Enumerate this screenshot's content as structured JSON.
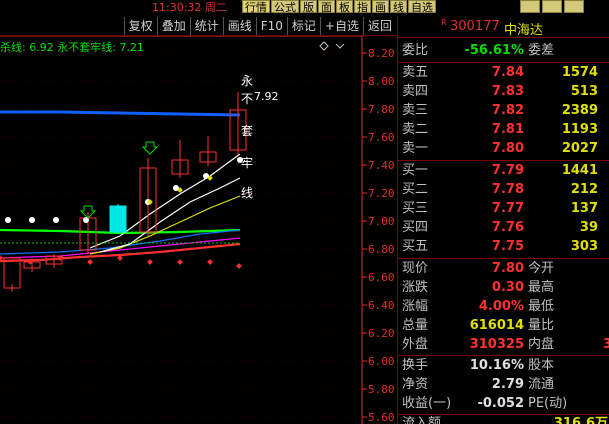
{
  "topbar": {
    "clock": "11:30:32 周二",
    "menu": [
      "行情",
      "公式",
      "版",
      "面",
      "板",
      "指",
      "画",
      "线",
      "自选"
    ],
    "menu_selected": 0
  },
  "toolbar": {
    "buttons": [
      "复权",
      "叠加",
      "统计",
      "画线",
      "F10",
      "标记",
      "+自选",
      "返回"
    ]
  },
  "chart": {
    "indicator_prefix": "杀线:",
    "indicator_value1": "6.92",
    "indicator_label2": "永不套牢线:",
    "indicator_value2": "7.21",
    "y_labels": [
      "8.20",
      "8.00",
      "7.80",
      "7.60",
      "7.40",
      "7.20",
      "7.00",
      "6.80",
      "6.60",
      "6.40",
      "6.20",
      "6.00",
      "5.80",
      "5.60"
    ],
    "annotation_chars": [
      "永",
      "不",
      "套",
      "牢",
      "线"
    ],
    "annotation_price": "7.92",
    "colors": {
      "up": "#ff3030",
      "down": "#00e8e8",
      "axis": "#e03030",
      "blue_line": "#1060ff"
    }
  },
  "quote": {
    "code": "300177",
    "name": "中海达",
    "mark": "R",
    "wei": {
      "label1": "委比",
      "value1": "-56.61%",
      "label2": "委差",
      "value2": ""
    },
    "sell": [
      {
        "label": "卖五",
        "price": "7.84",
        "vol": "1574"
      },
      {
        "label": "卖四",
        "price": "7.83",
        "vol": "513"
      },
      {
        "label": "卖三",
        "price": "7.82",
        "vol": "2389"
      },
      {
        "label": "卖二",
        "price": "7.81",
        "vol": "1193"
      },
      {
        "label": "卖一",
        "price": "7.80",
        "vol": "2027"
      }
    ],
    "buy": [
      {
        "label": "买一",
        "price": "7.79",
        "vol": "1441"
      },
      {
        "label": "买二",
        "price": "7.78",
        "vol": "212"
      },
      {
        "label": "买三",
        "price": "7.77",
        "vol": "137"
      },
      {
        "label": "买四",
        "price": "7.76",
        "vol": "39"
      },
      {
        "label": "买五",
        "price": "7.75",
        "vol": "303"
      }
    ],
    "stats": [
      {
        "l1": "现价",
        "v1": "7.80",
        "c1": "red",
        "l2": "今开",
        "v2": ""
      },
      {
        "l1": "涨跌",
        "v1": "0.30",
        "c1": "red",
        "l2": "最高",
        "v2": ""
      },
      {
        "l1": "涨幅",
        "v1": "4.00%",
        "c1": "red",
        "l2": "最低",
        "v2": ""
      },
      {
        "l1": "总量",
        "v1": "616014",
        "c1": "yellow",
        "l2": "量比",
        "v2": ""
      },
      {
        "l1": "外盘",
        "v1": "310325",
        "c1": "red",
        "l2": "内盘",
        "v2": "3"
      }
    ],
    "stats2": [
      {
        "l1": "换手",
        "v1": "10.16%",
        "c1": "white",
        "l2": "股本",
        "v2": ""
      },
      {
        "l1": "净资",
        "v1": "2.79",
        "c1": "white",
        "l2": "流通",
        "v2": ""
      },
      {
        "l1": "收益(一)",
        "v1": "-0.052",
        "c1": "white",
        "l2": "PE(动)",
        "v2": ""
      }
    ],
    "bottom_label": "流入额",
    "bottom_value": "316.6万"
  }
}
